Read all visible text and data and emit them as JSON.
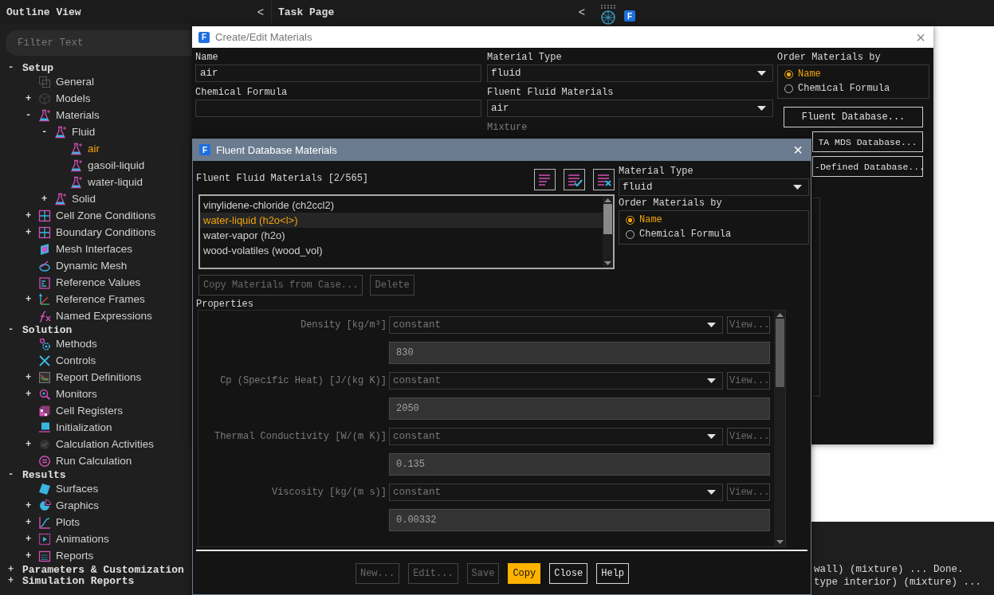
{
  "outline_view": {
    "title": "Outline View",
    "collapse": "<",
    "filter": {
      "placeholder": "Filter Text"
    },
    "sections": [
      {
        "label": "Setup",
        "toggle": "-",
        "children": [
          {
            "label": "General",
            "selected": false
          },
          {
            "label": "Models",
            "toggle": "+",
            "selected": false
          },
          {
            "label": "Materials",
            "toggle": "-",
            "selected": false,
            "children": [
              {
                "label": "Fluid",
                "toggle": "-",
                "selected": false,
                "children": [
                  {
                    "label": "air",
                    "selected": true
                  },
                  {
                    "label": "gasoil-liquid",
                    "selected": false
                  },
                  {
                    "label": "water-liquid",
                    "selected": false
                  }
                ]
              },
              {
                "label": "Solid",
                "toggle": "+",
                "selected": false
              }
            ]
          },
          {
            "label": "Cell Zone Conditions",
            "toggle": "+",
            "selected": false
          },
          {
            "label": "Boundary Conditions",
            "toggle": "+",
            "selected": false
          },
          {
            "label": "Mesh Interfaces",
            "selected": false
          },
          {
            "label": "Dynamic Mesh",
            "selected": false
          },
          {
            "label": "Reference Values",
            "selected": false
          },
          {
            "label": "Reference Frames",
            "toggle": "+",
            "selected": false
          },
          {
            "label": "Named Expressions",
            "selected": false
          }
        ]
      },
      {
        "label": "Solution",
        "toggle": "-",
        "children": [
          {
            "label": "Methods",
            "selected": false
          },
          {
            "label": "Controls",
            "selected": false
          },
          {
            "label": "Report Definitions",
            "toggle": "+",
            "selected": false
          },
          {
            "label": "Monitors",
            "toggle": "+",
            "selected": false
          },
          {
            "label": "Cell Registers",
            "selected": false
          },
          {
            "label": "Initialization",
            "selected": false
          },
          {
            "label": "Calculation Activities",
            "toggle": "+",
            "selected": false
          },
          {
            "label": "Run Calculation",
            "selected": false
          }
        ]
      },
      {
        "label": "Results",
        "toggle": "-",
        "children": [
          {
            "label": "Surfaces",
            "selected": false
          },
          {
            "label": "Graphics",
            "toggle": "+",
            "selected": false
          },
          {
            "label": "Plots",
            "toggle": "+",
            "selected": false
          },
          {
            "label": "Animations",
            "toggle": "+",
            "selected": false
          },
          {
            "label": "Reports",
            "toggle": "+",
            "selected": false
          }
        ]
      },
      {
        "label": "Parameters & Customization",
        "toggle": "+"
      },
      {
        "label": "Simulation Reports",
        "toggle": "+"
      }
    ]
  },
  "task_page": {
    "title": "Task Page",
    "collapse": "<"
  },
  "toolbar": {
    "logo": "F"
  },
  "console": {
    "lines": [
      "wall) (mixture) ... Done.",
      "type interior) (mixture) ..."
    ]
  },
  "create_edit_materials": {
    "logo": "F",
    "title": "Create/Edit Materials",
    "close": "×",
    "name": {
      "label": "Name",
      "value": "air"
    },
    "material_type": {
      "label": "Material Type",
      "value": "fluid"
    },
    "order_by": {
      "label": "Order Materials by",
      "options": [
        {
          "label": "Name",
          "selected": true
        },
        {
          "label": "Chemical Formula",
          "selected": false
        }
      ]
    },
    "chemical_formula": {
      "label": "Chemical Formula"
    },
    "fluent_fluid_materials": {
      "label": "Fluent Fluid Materials",
      "value": "air"
    },
    "mixture": {
      "label": "Mixture",
      "disabled": true
    },
    "database_buttons": [
      "Fluent Database...",
      "TA MDS Database...",
      "-Defined Database..."
    ]
  },
  "fluent_database_materials": {
    "logo": "F",
    "title": "Fluent Database Materials",
    "close": "×",
    "list_label": "Fluent Fluid Materials [2/565]",
    "materials": [
      {
        "label": "vinylidene-chloride (ch2ccl2)",
        "selected": false
      },
      {
        "label": "water-liquid (h2o<l>)",
        "selected": true
      },
      {
        "label": "water-vapor (h2o)",
        "selected": false
      },
      {
        "label": "wood-volatiles (wood_vol)",
        "selected": false
      }
    ],
    "list_actions": [
      {
        "label": "Copy Materials from Case...",
        "disabled": true
      },
      {
        "label": "Delete",
        "disabled": true
      }
    ],
    "material_type": {
      "label": "Material Type",
      "value": "fluid"
    },
    "order_by": {
      "label": "Order Materials by",
      "options": [
        {
          "label": "Name",
          "selected": true
        },
        {
          "label": "Chemical Formula",
          "selected": false
        }
      ]
    },
    "properties_label": "Properties",
    "properties": [
      {
        "label": "Density [kg/m³]",
        "method": "constant",
        "view": "View...",
        "value": "830",
        "disabled": true
      },
      {
        "label": "Cp (Specific Heat) [J/(kg K)]",
        "method": "constant",
        "view": "View...",
        "value": "2050",
        "disabled": true
      },
      {
        "label": "Thermal Conductivity [W/(m K)]",
        "method": "constant",
        "view": "View...",
        "value": "0.135",
        "disabled": true
      },
      {
        "label": "Viscosity [kg/(m s)]",
        "method": "constant",
        "view": "View...",
        "value": "0.00332",
        "disabled": true
      }
    ],
    "buttons": [
      {
        "label": "New...",
        "disabled": true,
        "highlighted": false
      },
      {
        "label": "Edit...",
        "disabled": true,
        "highlighted": false
      },
      {
        "label": "Save",
        "disabled": true,
        "highlighted": false
      },
      {
        "label": "Copy",
        "disabled": false,
        "highlighted": true
      },
      {
        "label": "Close",
        "disabled": false,
        "highlighted": false
      },
      {
        "label": "Help",
        "disabled": false,
        "highlighted": false
      }
    ]
  }
}
